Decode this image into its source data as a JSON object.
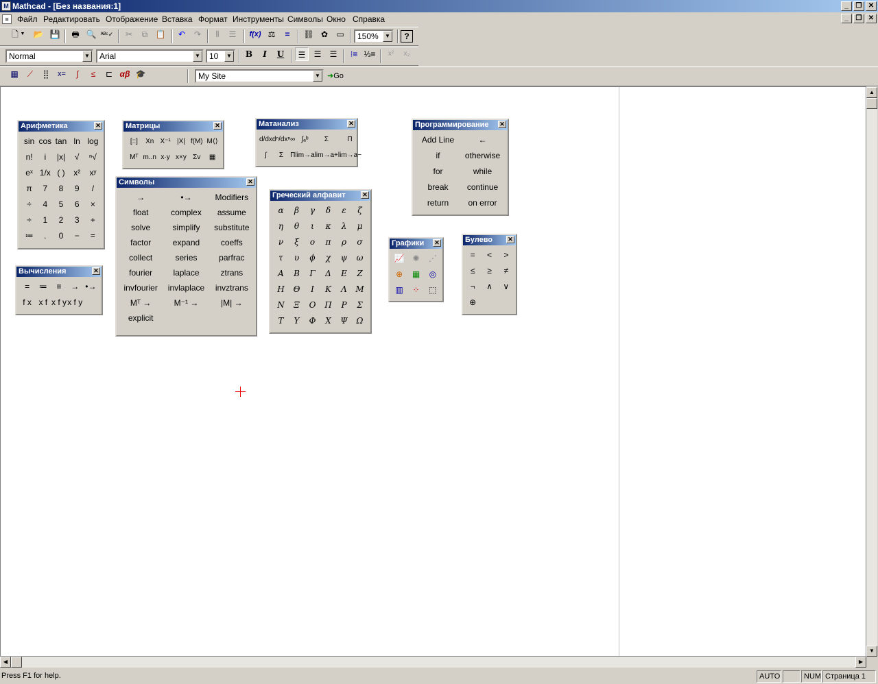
{
  "window": {
    "title": "Mathcad - [Без названия:1]",
    "app_icon": "mathcad-icon"
  },
  "menu": [
    "Файл",
    "Редактировать",
    "Отображение",
    "Вставка",
    "Формат",
    "Инструменты",
    "Символы",
    "Окно",
    "Справка"
  ],
  "standard_toolbar": {
    "zoom": "150%"
  },
  "format_toolbar": {
    "style": "Normal",
    "font": "Arial",
    "size": "10",
    "bold": "B",
    "italic": "I",
    "underline": "U"
  },
  "math_toolbar": {
    "site": "My Site",
    "go": "Go"
  },
  "palettes": {
    "arithmetic": {
      "title": "Арифметика",
      "cells": [
        "sin",
        "cos",
        "tan",
        "ln",
        "log",
        "n!",
        "i",
        "|x|",
        "√",
        "ⁿ√",
        "eˣ",
        "1/x",
        "( )",
        "x²",
        "xʸ",
        "π",
        "7",
        "8",
        "9",
        "/",
        "÷",
        "4",
        "5",
        "6",
        "×",
        "÷",
        "1",
        "2",
        "3",
        "+",
        "≔",
        ".",
        "0",
        "−",
        "="
      ]
    },
    "evaluation": {
      "title": "Вычисления",
      "cells": [
        "=",
        "≔",
        "≡",
        "→",
        "•→",
        "f x",
        "x f",
        "x f y",
        "x f y"
      ]
    },
    "matrix": {
      "title": "Матрицы",
      "cells": [
        "[::]",
        "Xn",
        "X⁻¹",
        "|X|",
        "f(M)",
        "M⟨⟩",
        "Mᵀ",
        "m..n",
        "x·y",
        "x×y",
        "Σv",
        "▦"
      ]
    },
    "calculus": {
      "title": "Матанализ",
      "cells": [
        "d/dx",
        "dⁿ/dxⁿ",
        "∞",
        "∫ₐᵇ",
        "Σ",
        "Π",
        "∫",
        "Σ",
        "Π",
        "lim→a",
        "lim→a+",
        "lim→a−"
      ]
    },
    "symbols": {
      "title": "Символы",
      "cells": [
        "→",
        "•→",
        "Modifiers",
        "float",
        "complex",
        "assume",
        "solve",
        "simplify",
        "substitute",
        "factor",
        "expand",
        "coeffs",
        "collect",
        "series",
        "parfrac",
        "fourier",
        "laplace",
        "ztrans",
        "invfourier",
        "invlaplace",
        "invztrans",
        "Mᵀ →",
        "M⁻¹ →",
        "|M| →",
        "explicit",
        "",
        ""
      ]
    },
    "greek": {
      "title": "Греческий алфавит",
      "cells": [
        "α",
        "β",
        "γ",
        "δ",
        "ε",
        "ζ",
        "η",
        "θ",
        "ι",
        "κ",
        "λ",
        "μ",
        "ν",
        "ξ",
        "ο",
        "π",
        "ρ",
        "σ",
        "τ",
        "υ",
        "ϕ",
        "χ",
        "ψ",
        "ω",
        "Α",
        "Β",
        "Γ",
        "Δ",
        "Ε",
        "Ζ",
        "Η",
        "Θ",
        "Ι",
        "Κ",
        "Λ",
        "Μ",
        "Ν",
        "Ξ",
        "Ο",
        "Π",
        "Ρ",
        "Σ",
        "Τ",
        "Υ",
        "Φ",
        "Χ",
        "Ψ",
        "Ω"
      ]
    },
    "programming": {
      "title": "Программирование",
      "cells": [
        "Add Line",
        "←",
        "if",
        "otherwise",
        "for",
        "while",
        "break",
        "continue",
        "return",
        "on error"
      ]
    },
    "graphs": {
      "title": "Графики",
      "cells": [
        "xy-plot-icon",
        "polar-plot-icon",
        "surface-plot-icon",
        "contour-plot-icon",
        "3d-bar-icon",
        "scatter-icon",
        "bar3d-icon",
        "vector-field-icon",
        "3d-scatter-icon"
      ]
    },
    "boolean": {
      "title": "Булево",
      "cells": [
        "=",
        "<",
        ">",
        "≤",
        "≥",
        "≠",
        "¬",
        "∧",
        "∨",
        "⊕",
        "",
        ""
      ]
    }
  },
  "status": {
    "help": "Press F1 for help.",
    "auto": "AUTO",
    "caps": "",
    "num": "NUM",
    "page": "Страница 1"
  }
}
